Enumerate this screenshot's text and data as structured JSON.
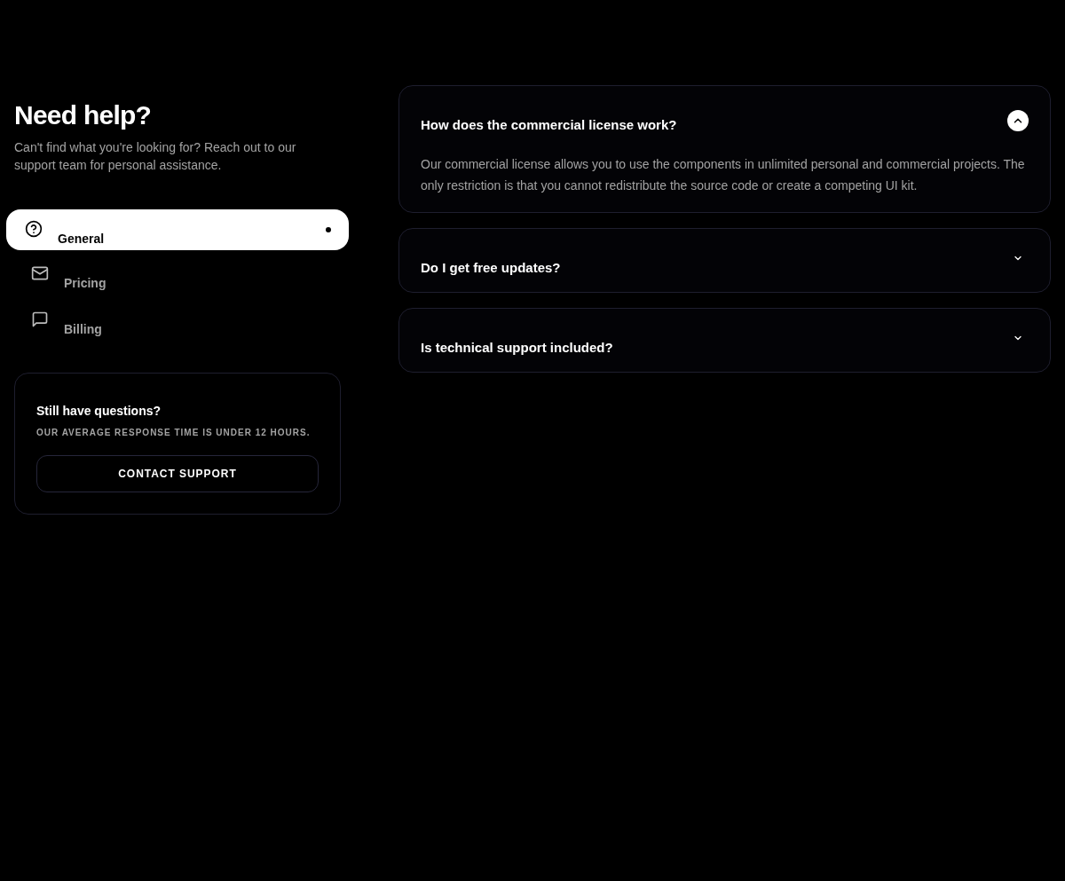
{
  "heading": "Need help?",
  "intro": "Can't find what you're looking for? Reach out to our support team for personal assistance.",
  "categories": [
    {
      "label": "General",
      "selected": true
    },
    {
      "label": "Pricing",
      "selected": false
    },
    {
      "label": "Billing",
      "selected": false
    }
  ],
  "support_card": {
    "title": "Still have questions?",
    "subtitle": "OUR AVERAGE RESPONSE TIME IS UNDER 12 HOURS.",
    "button": "CONTACT SUPPORT"
  },
  "faqs": [
    {
      "question": "How does the commercial license work?",
      "expanded": true,
      "answer": "Our commercial license allows you to use the components in unlimited personal and commercial projects. The only restriction is that you cannot redistribute the source code or create a competing UI kit."
    },
    {
      "question": "Do I get free updates?",
      "expanded": false
    },
    {
      "question": "Is technical support included?",
      "expanded": false
    }
  ]
}
